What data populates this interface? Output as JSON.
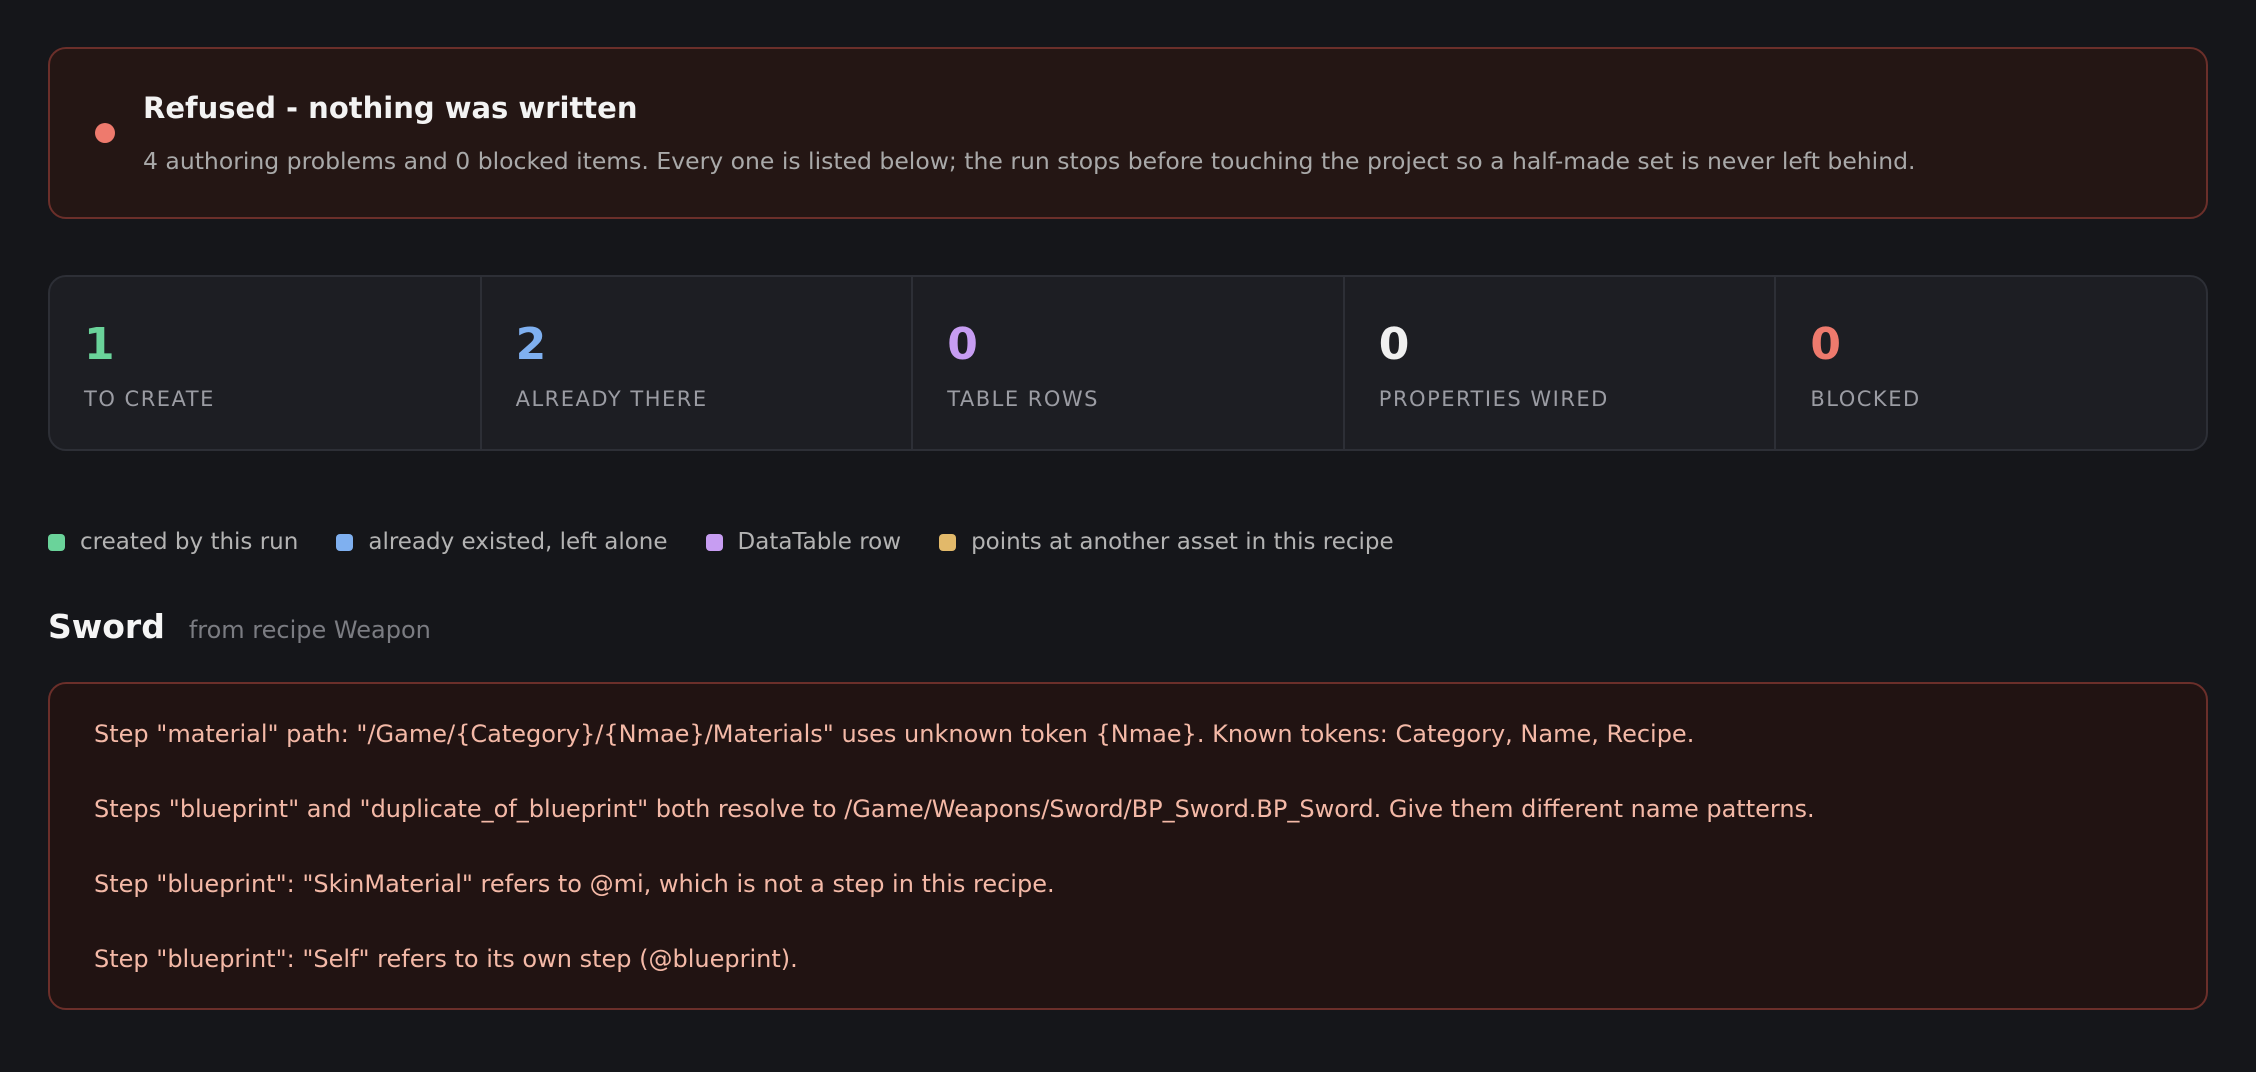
{
  "banner": {
    "title": "Refused - nothing was written",
    "message": "4 authoring problems and 0 blocked items. Every one is listed below; the run stops before touching the project so a half-made set is never left behind.",
    "status_color": "#ee7a6d"
  },
  "stats": [
    {
      "value": "1",
      "label": "TO CREATE",
      "color": "#6ad39a"
    },
    {
      "value": "2",
      "label": "ALREADY THERE",
      "color": "#7fb0f0"
    },
    {
      "value": "0",
      "label": "TABLE ROWS",
      "color": "#c79df2"
    },
    {
      "value": "0",
      "label": "PROPERTIES WIRED",
      "color": "#f0f0f0"
    },
    {
      "value": "0",
      "label": "BLOCKED",
      "color": "#ee7a6d"
    }
  ],
  "legend": [
    {
      "label": "created by this run",
      "color": "#6ad39a"
    },
    {
      "label": "already existed, left alone",
      "color": "#7fb0f0"
    },
    {
      "label": "DataTable row",
      "color": "#c79df2"
    },
    {
      "label": "points at another asset in this recipe",
      "color": "#e2b96a"
    }
  ],
  "recipe": {
    "name": "Sword",
    "source": "from recipe Weapon"
  },
  "errors": [
    "Step \"material\" path: \"/Game/{Category}/{Nmae}/Materials\" uses unknown token {Nmae}. Known tokens: Category, Name, Recipe.",
    "Steps \"blueprint\" and \"duplicate_of_blueprint\" both resolve to /Game/Weapons/Sword/BP_Sword.BP_Sword. Give them different name patterns.",
    "Step \"blueprint\": \"SkinMaterial\" refers to @mi, which is not a step in this recipe.",
    "Step \"blueprint\": \"Self\" refers to its own step (@blueprint)."
  ]
}
